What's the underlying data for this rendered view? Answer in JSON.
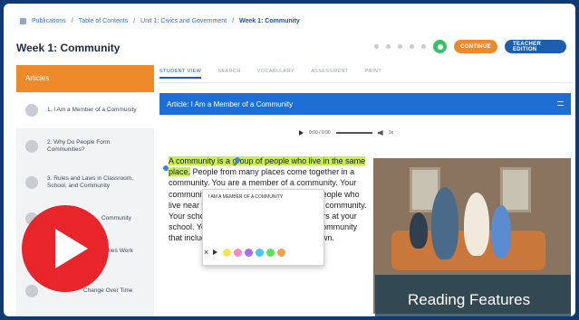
{
  "breadcrumb": {
    "items": [
      "Publications",
      "Table of Contents",
      "Unit 1: Civics and Government"
    ],
    "current": "Week 1: Community"
  },
  "page_title": "Week 1: Community",
  "header": {
    "orange_button": "CONTINUE",
    "blue_button": "TEACHER EDITION"
  },
  "sidebar": {
    "heading": "Articles",
    "items": [
      {
        "label": "1. I Am a Member of a Community"
      },
      {
        "label": "2. Why Do People Form Communities?"
      },
      {
        "label": "3. Rules and Laws in Classroom, School, and Community"
      },
      {
        "label": "Community"
      },
      {
        "label": "Communities Work Together"
      },
      {
        "label": "Change Over Time"
      }
    ]
  },
  "tabs": [
    "STUDENT VIEW",
    "SEARCH",
    "VOCABULARY",
    "ASSESSMENT",
    "PRINT"
  ],
  "article": {
    "title": "Article: I Am a Member of a Community",
    "audio_time": "0:00 / 0:00",
    "audio_speed": "1x",
    "body_highlight_a": "A community",
    "body_highlight_b": " is a group of people who live in the same place.",
    "body_rest": " People from many places come together in a community. You are a member of a community. Your community you are a part of includes the people who live near you. You are a part of your school community. Your school has other students and teachers at your school. You are also a member of a local community that includes your neighborhood, city, or town."
  },
  "popup": {
    "title": "I AM A MEMBER OF A COMMUNITY",
    "close": "×",
    "swatch_colors": [
      "#f5e64a",
      "#f58ac6",
      "#b06cf0",
      "#44c8f0",
      "#5be05b",
      "#f0a24a"
    ]
  },
  "overlay": {
    "caption": "Reading Features"
  },
  "colors": {
    "accent_orange": "#ef8a2b",
    "accent_blue": "#1d5fae",
    "highlight": "#c5ef4c",
    "play_red": "#e7252b"
  }
}
